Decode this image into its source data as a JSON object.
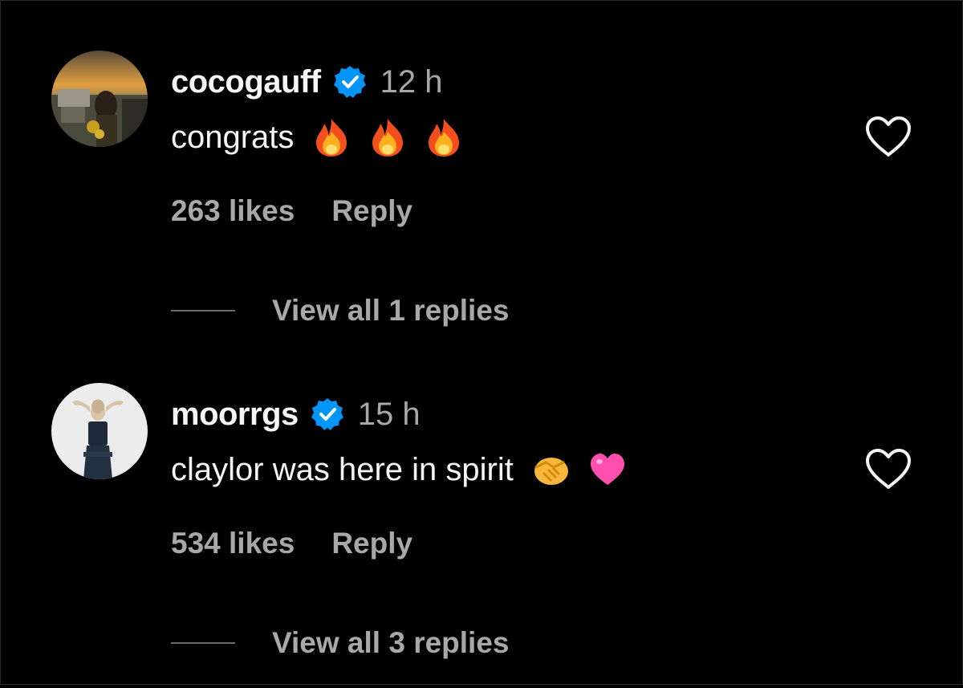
{
  "colors": {
    "background": "#000000",
    "text_primary": "#f5f5f5",
    "text_secondary": "#a8a8a8",
    "verified_blue": "#0095f6",
    "fire_orange": "#f7931e",
    "heart_pink": "#ff4fae"
  },
  "comments": [
    {
      "username": "cocogauff",
      "verified": true,
      "verified_icon": "verified-badge-icon",
      "time": "12 h",
      "text": "congrats",
      "emojis": [
        "fire-emoji",
        "fire-emoji",
        "fire-emoji"
      ],
      "likes": "263 likes",
      "reply_label": "Reply",
      "view_replies": "View all 1 replies",
      "like_icon": "heart-outline-icon"
    },
    {
      "username": "moorrgs",
      "verified": true,
      "verified_icon": "verified-badge-icon",
      "time": "15 h",
      "text": "claylor was here in spirit",
      "emojis": [
        "handshake-emoji",
        "pink-heart-emoji"
      ],
      "likes": "534 likes",
      "reply_label": "Reply",
      "view_replies": "View all 3 replies",
      "like_icon": "heart-outline-icon"
    }
  ]
}
